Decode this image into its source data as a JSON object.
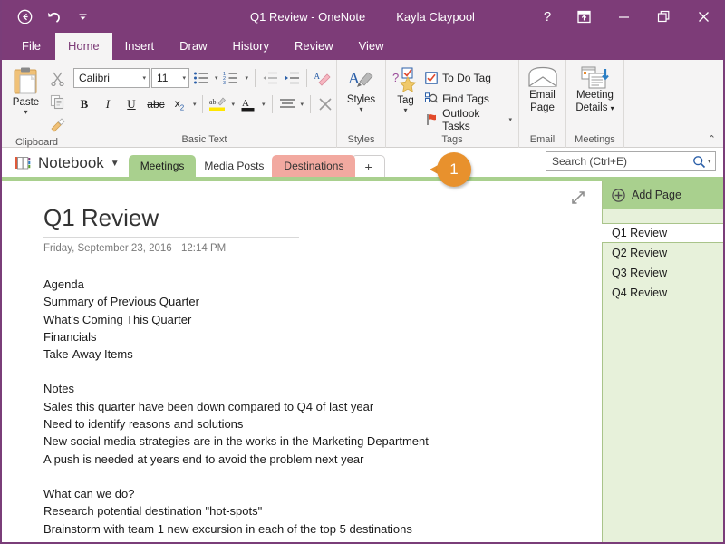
{
  "titlebar": {
    "back_icon": "back-arrow-circle-icon",
    "undo_icon": "undo-arrow-icon",
    "qat_caret_icon": "quick-access-dropdown-icon",
    "title": "Q1 Review - OneNote",
    "user": "Kayla Claypool",
    "help_label": "?",
    "ribbon_display_icon": "ribbon-display-options-icon",
    "minimize_icon": "minimize-icon",
    "restore_icon": "restore-icon",
    "close_icon": "close-icon"
  },
  "ribbon_tabs": [
    {
      "label": "File",
      "active": false
    },
    {
      "label": "Home",
      "active": true
    },
    {
      "label": "Insert",
      "active": false
    },
    {
      "label": "Draw",
      "active": false
    },
    {
      "label": "History",
      "active": false
    },
    {
      "label": "Review",
      "active": false
    },
    {
      "label": "View",
      "active": false
    }
  ],
  "ribbon": {
    "clipboard": {
      "group_label": "Clipboard",
      "paste_label": "Paste",
      "paste_icon": "paste-icon",
      "cut_icon": "cut-scissors-icon",
      "copy_icon": "copy-icon",
      "format_painter_icon": "format-painter-icon"
    },
    "basic_text": {
      "group_label": "Basic Text",
      "font_name": "Calibri",
      "font_size": "11",
      "bullets_icon": "bullet-list-icon",
      "numbering_icon": "numbered-list-icon",
      "decrease_indent_icon": "decrease-indent-icon",
      "increase_indent_icon": "increase-indent-icon",
      "clear_formatting_icon": "clear-formatting-icon",
      "bold_label": "B",
      "italic_label": "I",
      "underline_label": "U",
      "strikethrough_label": "abc",
      "subscript_label": "x",
      "subscript_sub": "2",
      "highlight_icon": "text-highlight-icon",
      "font_color_label": "A",
      "align_icon": "align-text-icon",
      "remove_icon": "remove-formatting-x-icon"
    },
    "styles": {
      "group_label": "Styles",
      "button_label": "Styles",
      "icon": "styles-icon"
    },
    "tags": {
      "group_label": "Tags",
      "tag_button_label": "Tag",
      "tag_icon": "tag-star-icon",
      "items": [
        {
          "label": "To Do Tag",
          "icon": "checkbox-checked-icon"
        },
        {
          "label": "Find Tags",
          "icon": "find-tags-magnifier-icon"
        },
        {
          "label": "Outlook Tasks",
          "icon": "outlook-flag-icon",
          "caret": true
        }
      ]
    },
    "email": {
      "group_label": "Email",
      "button_label_line1": "Email",
      "button_label_line2": "Page",
      "icon": "envelope-icon"
    },
    "meetings": {
      "group_label": "Meetings",
      "button_label_line1": "Meeting",
      "button_label_line2": "Details",
      "icon": "meeting-details-icon"
    },
    "collapse_icon": "collapse-ribbon-chevron-icon"
  },
  "section_bar": {
    "notebook_icon": "notebook-icon",
    "notebook_label": "Notebook",
    "notebook_caret_icon": "chevron-down-icon",
    "tabs": [
      {
        "label": "Meetings",
        "color": "#a9d08e",
        "active": true
      },
      {
        "label": "Media Posts",
        "color": "#eda3cb",
        "active": false
      },
      {
        "label": "Destinations",
        "color": "#f2a9a0",
        "active": false
      }
    ],
    "add_section_label": "+",
    "search": {
      "placeholder": "Search (Ctrl+E)",
      "value": "",
      "icon": "search-magnifier-icon",
      "caret_icon": "search-scope-dropdown-icon"
    }
  },
  "callout": {
    "number": "1",
    "color": "#e8912d"
  },
  "page": {
    "expand_icon": "expand-diagonal-arrows-icon",
    "title": "Q1 Review",
    "date": "Friday, September 23, 2016",
    "time": "12:14 PM",
    "blocks": [
      [
        "Agenda",
        "Summary of Previous Quarter",
        "What's Coming This Quarter",
        "Financials",
        "Take-Away Items"
      ],
      [
        "Notes",
        "Sales this quarter have been down compared to Q4 of last year",
        "Need to identify reasons and solutions",
        "New social media strategies are in the works in the Marketing Department",
        "A push is needed at years end to avoid the problem next year"
      ],
      [
        "What can we do?",
        "Research potential destination \"hot-spots\"",
        "Brainstorm with team 1 new excursion in each of the top 5 destinations"
      ]
    ]
  },
  "pages_pane": {
    "add_page_label": "Add Page",
    "add_page_icon": "add-circle-icon",
    "items": [
      {
        "label": "Q1 Review",
        "selected": true
      },
      {
        "label": "Q2 Review",
        "selected": false
      },
      {
        "label": "Q3 Review",
        "selected": false
      },
      {
        "label": "Q4 Review",
        "selected": false
      }
    ]
  }
}
